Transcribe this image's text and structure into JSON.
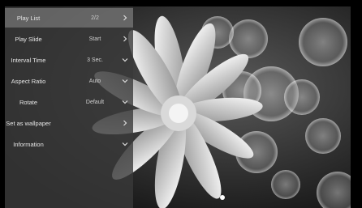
{
  "menu": {
    "items": [
      {
        "label": "Play List",
        "value": "2/2",
        "icon": "chevron-right-icon"
      },
      {
        "label": "Play Slide",
        "value": "Start",
        "icon": "chevron-right-icon"
      },
      {
        "label": "Interval Time",
        "value": "3 Sec.",
        "icon": "chevron-down-icon"
      },
      {
        "label": "Aspect Ratio",
        "value": "Auto",
        "icon": "chevron-down-icon"
      },
      {
        "label": "Rotate",
        "value": "Default",
        "icon": "chevron-down-icon"
      },
      {
        "label": "Set as wallpaper",
        "value": "",
        "icon": "chevron-right-icon"
      },
      {
        "label": "Information",
        "value": "",
        "icon": "chevron-down-icon"
      }
    ],
    "selected_index": 0
  }
}
